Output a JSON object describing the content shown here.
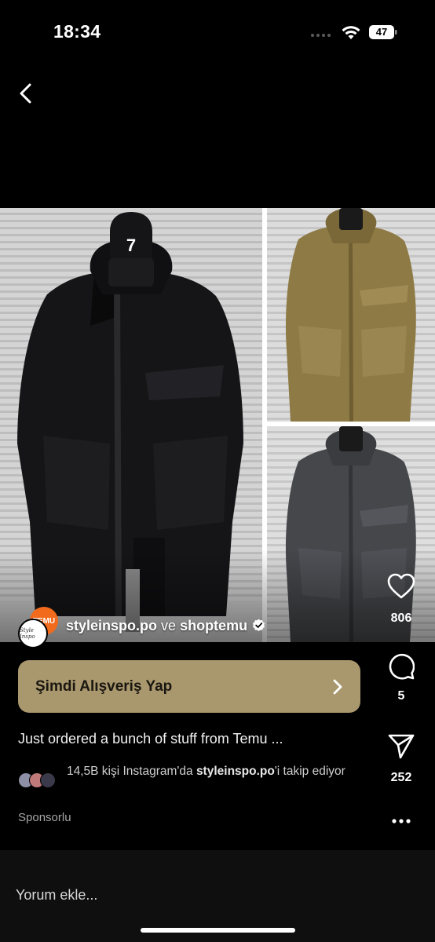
{
  "status_bar": {
    "time": "18:34",
    "battery": "47"
  },
  "post": {
    "accounts": {
      "primary": "styleinspo.po",
      "conjunction": "ve",
      "secondary": "shoptemu"
    },
    "avatar_a_text": "TEMU",
    "avatar_b_text": "Style Inspo",
    "likes": "806",
    "comments": "5",
    "shares": "252",
    "cta_label": "Şimdi Alışveriş Yap",
    "caption": "Just ordered a bunch of stuff from Temu ...",
    "followers": {
      "prefix": "14,5B kişi Instagram'da ",
      "account": "styleinspo.po",
      "suffix": "'i takip ediyor"
    },
    "sponsored_label": "Sponsorlu"
  },
  "comment_bar": {
    "placeholder": "Yorum ekle..."
  },
  "colors": {
    "cta_bg": "#a9976d",
    "background": "#000000",
    "temu_orange": "#f26a1b"
  },
  "icons": [
    "back-icon",
    "heart-icon",
    "comment-icon",
    "send-icon",
    "more-icon",
    "verified-badge-icon",
    "chevron-right-icon",
    "wifi-icon",
    "battery-icon"
  ]
}
